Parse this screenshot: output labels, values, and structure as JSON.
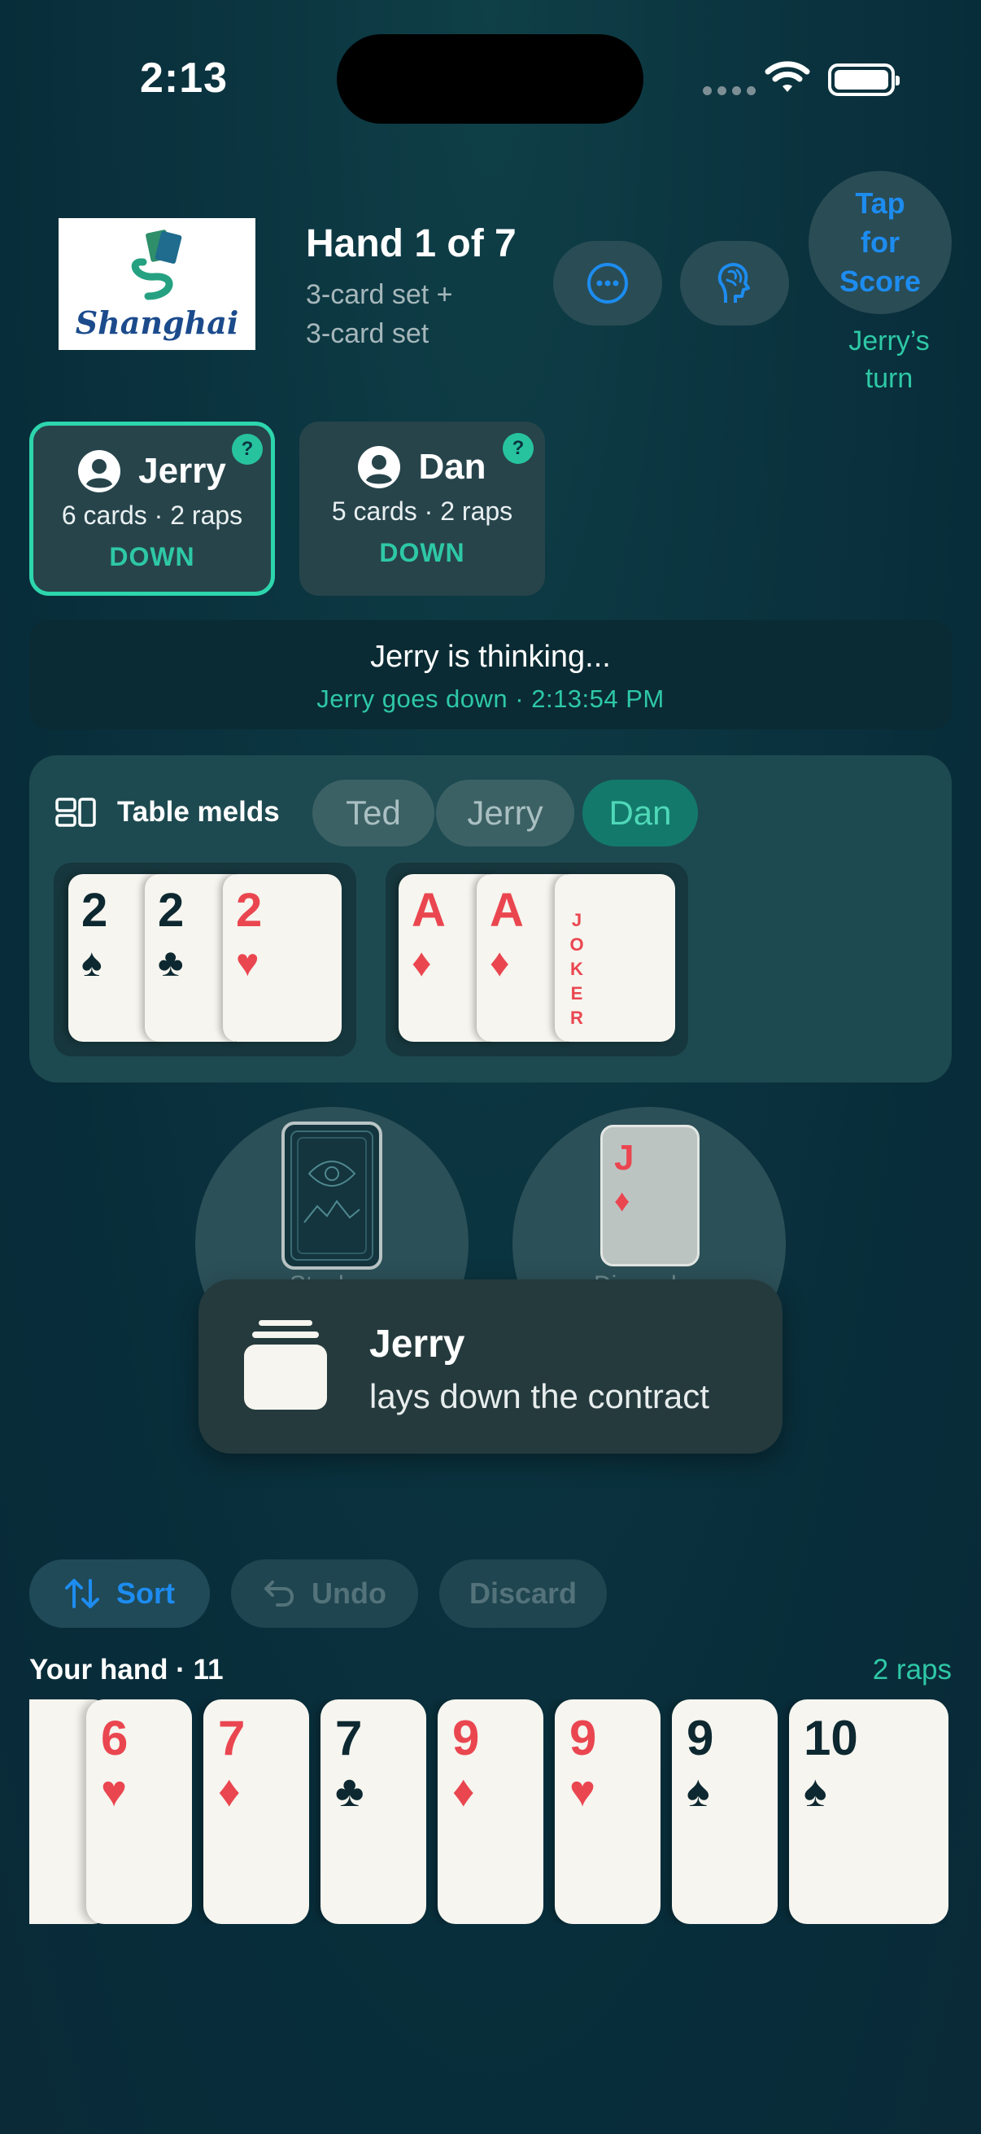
{
  "status_bar": {
    "time": "2:13"
  },
  "header": {
    "logo_text": "Shanghai",
    "title": "Hand 1 of 7",
    "subtitle_line1": "3-card set +",
    "subtitle_line2": "3-card set",
    "more_icon": "ellipsis-circle-icon",
    "brain_icon": "brain-icon",
    "score_button": [
      "Tap",
      "for",
      "Score"
    ],
    "turn_line1": "Jerry’s",
    "turn_line2": "turn"
  },
  "players": [
    {
      "name": "Jerry",
      "info": "6 cards · 2 raps",
      "status": "DOWN",
      "badge": "?",
      "active": true
    },
    {
      "name": "Dan",
      "info": "5 cards · 2 raps",
      "status": "DOWN",
      "badge": "?",
      "active": false
    }
  ],
  "banner": {
    "main": "Jerry is thinking...",
    "sub": "Jerry goes down · 2:13:54 PM"
  },
  "melds": {
    "label": "Table melds",
    "tabs": [
      "Ted",
      "Jerry",
      "Dan"
    ],
    "active_tab": "Dan",
    "groups": [
      [
        {
          "rank": "2",
          "suit": "♠"
        },
        {
          "rank": "2",
          "suit": "♣"
        },
        {
          "rank": "2",
          "suit": "♥"
        }
      ],
      [
        {
          "rank": "A",
          "suit": "♦"
        },
        {
          "rank": "A",
          "suit": "♦"
        },
        {
          "rank": "JOKER",
          "suit": ""
        }
      ]
    ]
  },
  "piles": {
    "stock_label": "Stock",
    "discard_label": "Discard",
    "discard_top": {
      "rank": "J",
      "suit": "♦"
    }
  },
  "toast": {
    "title": "Jerry",
    "text": "lays down the contract"
  },
  "actions": {
    "sort": "Sort",
    "undo": "Undo",
    "discard": "Discard"
  },
  "hand": {
    "label": "Your hand · 11",
    "raps": "2 raps",
    "cards": [
      {
        "rank": "6",
        "suit": "♥"
      },
      {
        "rank": "7",
        "suit": "♦"
      },
      {
        "rank": "7",
        "suit": "♣"
      },
      {
        "rank": "9",
        "suit": "♦"
      },
      {
        "rank": "9",
        "suit": "♥"
      },
      {
        "rank": "9",
        "suit": "♠"
      },
      {
        "rank": "10",
        "suit": "♠"
      }
    ]
  },
  "colors": {
    "accent": "#2ec8a6",
    "link": "#1d8cf0",
    "red_suit": "#ea4650",
    "dark_suit": "#0d2830"
  }
}
